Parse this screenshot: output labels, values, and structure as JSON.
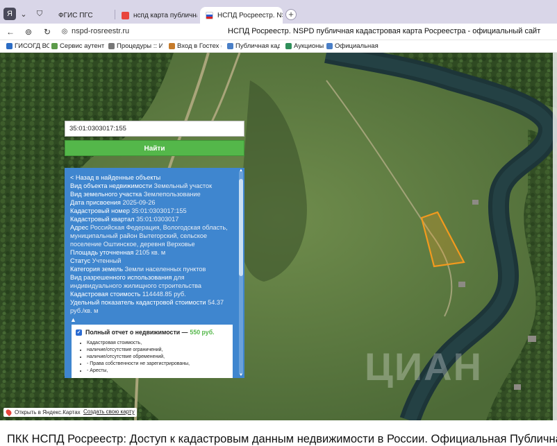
{
  "browser": {
    "tabs": [
      {
        "label": "ФГИС ПГС",
        "active": false
      },
      {
        "label": "нспд карта публичная кад",
        "active": false
      },
      {
        "label": "НСПД Росреестр. NSP",
        "active": true
      }
    ],
    "url": "nspd-rosreestr.ru",
    "title": "НСПД Росреестр. NSPD публичная кадастровая карта Росреестра - официальный сайт",
    "bookmarks": [
      "ГИСОГД ВО",
      "Сервис аутентиф",
      "Процедуры :: Им",
      "Вход в Гостех (Ау",
      "Публичная кадас",
      "Аукционы",
      "Официальная ка"
    ]
  },
  "search": {
    "value": "35:01:0303017:155",
    "button": "Найти"
  },
  "info": {
    "back": "< Назад в найденные объекты",
    "rows": [
      {
        "k": "Вид объекта недвижимости",
        "v": "Земельный участок"
      },
      {
        "k": "Вид земельного участка",
        "v": "Землепользование"
      },
      {
        "k": "Дата присвоения",
        "v": "2025-09-26"
      },
      {
        "k": "Кадастровый номер",
        "v": "35:01:0303017:155"
      },
      {
        "k": "Кадастровый квартал",
        "v": "35:01:0303017"
      },
      {
        "k": "Адрес",
        "v": "Российская Федерация, Вологодская область, муниципальный район Вытегорский, сельское поселение Оштинское, деревня Верховье"
      },
      {
        "k": "Площадь уточненная",
        "v": "2105 кв. м"
      },
      {
        "k": "Статус",
        "v": "Учтенный"
      },
      {
        "k": "Категория земель",
        "v": "Земли населенных пунктов"
      },
      {
        "k": "Вид разрешенного использования",
        "v": "для индивидуального жилищного строительства"
      },
      {
        "k": "Кадастровая стоимость",
        "v": "114448.85 руб."
      },
      {
        "k": "Удельный показатель кадастровой стоимости",
        "v": "54.37 руб./кв. м"
      }
    ],
    "collapse_arrow": "▲"
  },
  "report": {
    "title": "Полный отчет о недвижимости —",
    "price": "550 руб.",
    "items": [
      "Кадастровая стоимость,",
      "наличие/отсутствие ограничений,",
      "наличие/отсутствие обременений,",
      "- Права собственности не зарегистрированы,",
      "- Аресты,"
    ]
  },
  "map_buttons": {
    "yandex": "Открыть в Яндекс.Картах",
    "create": "Создать свою карту"
  },
  "watermark": "ЦИАН",
  "caption": "ПКК НСПД Росреестр: Доступ к кадастровым данным недвижимости в России. Официальная Публичная ка",
  "colors": {
    "panel": "#3f86cf",
    "find_button": "#54b74a",
    "parcel": "#f39a1e"
  }
}
